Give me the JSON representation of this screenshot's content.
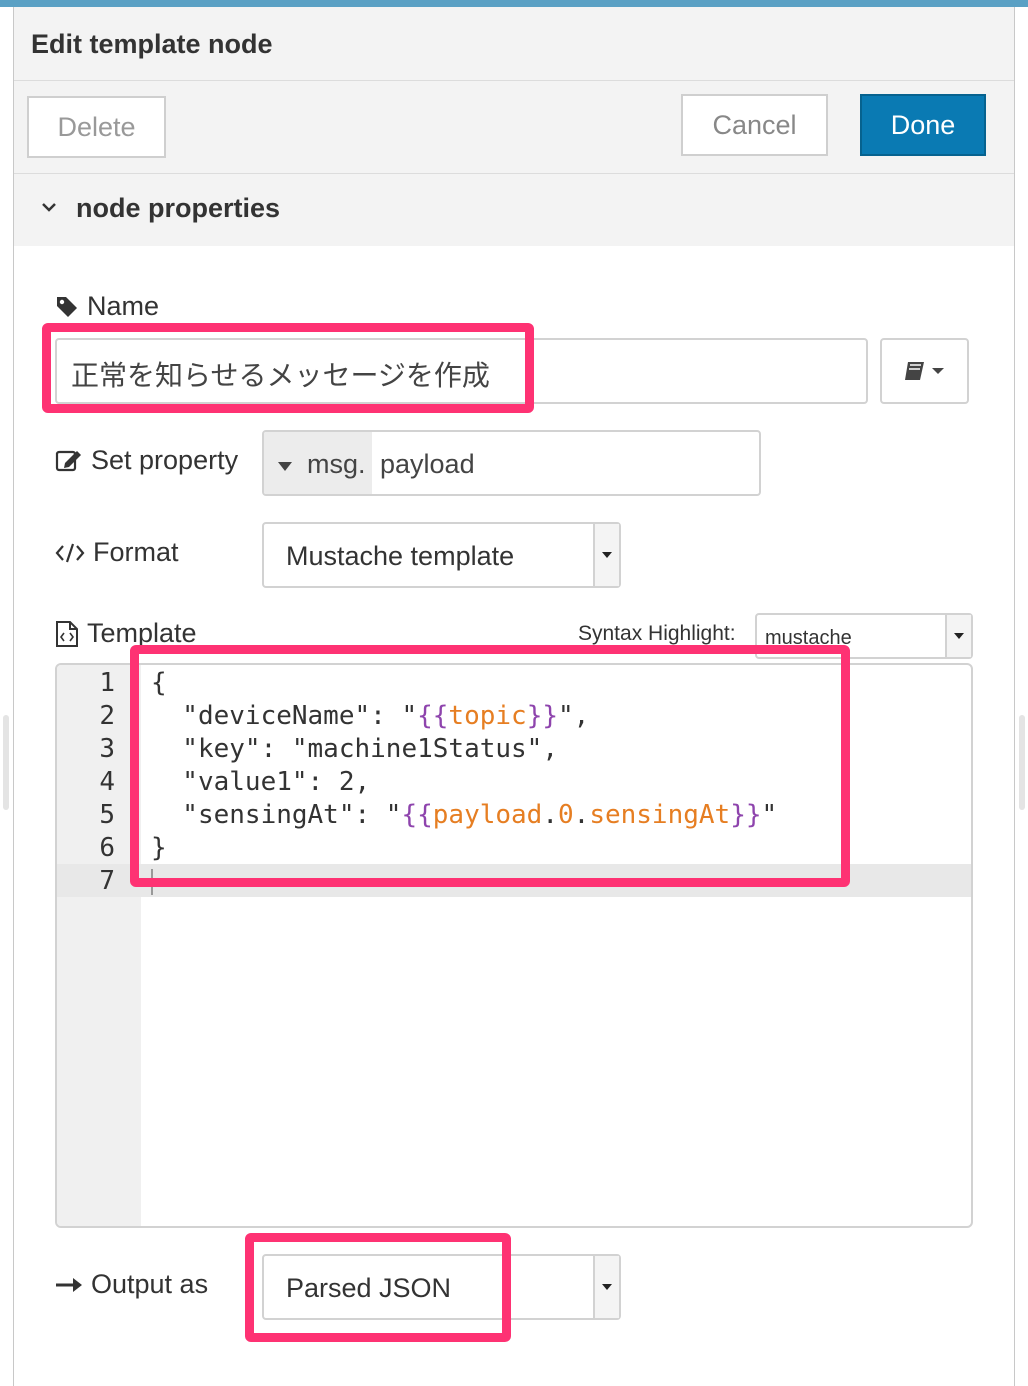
{
  "dialog": {
    "title": "Edit template node",
    "delete_label": "Delete",
    "cancel_label": "Cancel",
    "done_label": "Done",
    "section_title": "node properties"
  },
  "form": {
    "name_label": "Name",
    "name_value": "正常を知らせるメッセージを作成",
    "set_property_label": "Set property",
    "property_prefix": "msg.",
    "property_value": "payload",
    "format_label": "Format",
    "format_value": "Mustache template",
    "template_label": "Template",
    "syntax_label": "Syntax Highlight:",
    "syntax_value": "mustache",
    "output_label": "Output as",
    "output_value": "Parsed JSON"
  },
  "editor": {
    "line_numbers": [
      "1",
      "2",
      "3",
      "4",
      "5",
      "6",
      "7"
    ],
    "lines": [
      "{",
      "  \"deviceName\": \"{{topic}}\",",
      "  \"key\": \"machine1Status\",",
      "  \"value1\": 2,",
      "  \"sensingAt\": \"{{payload.0.sensingAt}}\"",
      "}",
      ""
    ]
  },
  "icons": {
    "section_toggle": "chevron-down-icon",
    "name": "tag-icon",
    "set_property": "edit-icon",
    "format": "code-icon",
    "template": "file-code-icon",
    "output": "arrow-right-icon",
    "name_menu": "book-icon"
  },
  "colors": {
    "accent": "#0a7ab3",
    "highlight_box": "#fe3273",
    "mustache_brace": "#8e44ad",
    "mustache_var": "#e67e22"
  }
}
